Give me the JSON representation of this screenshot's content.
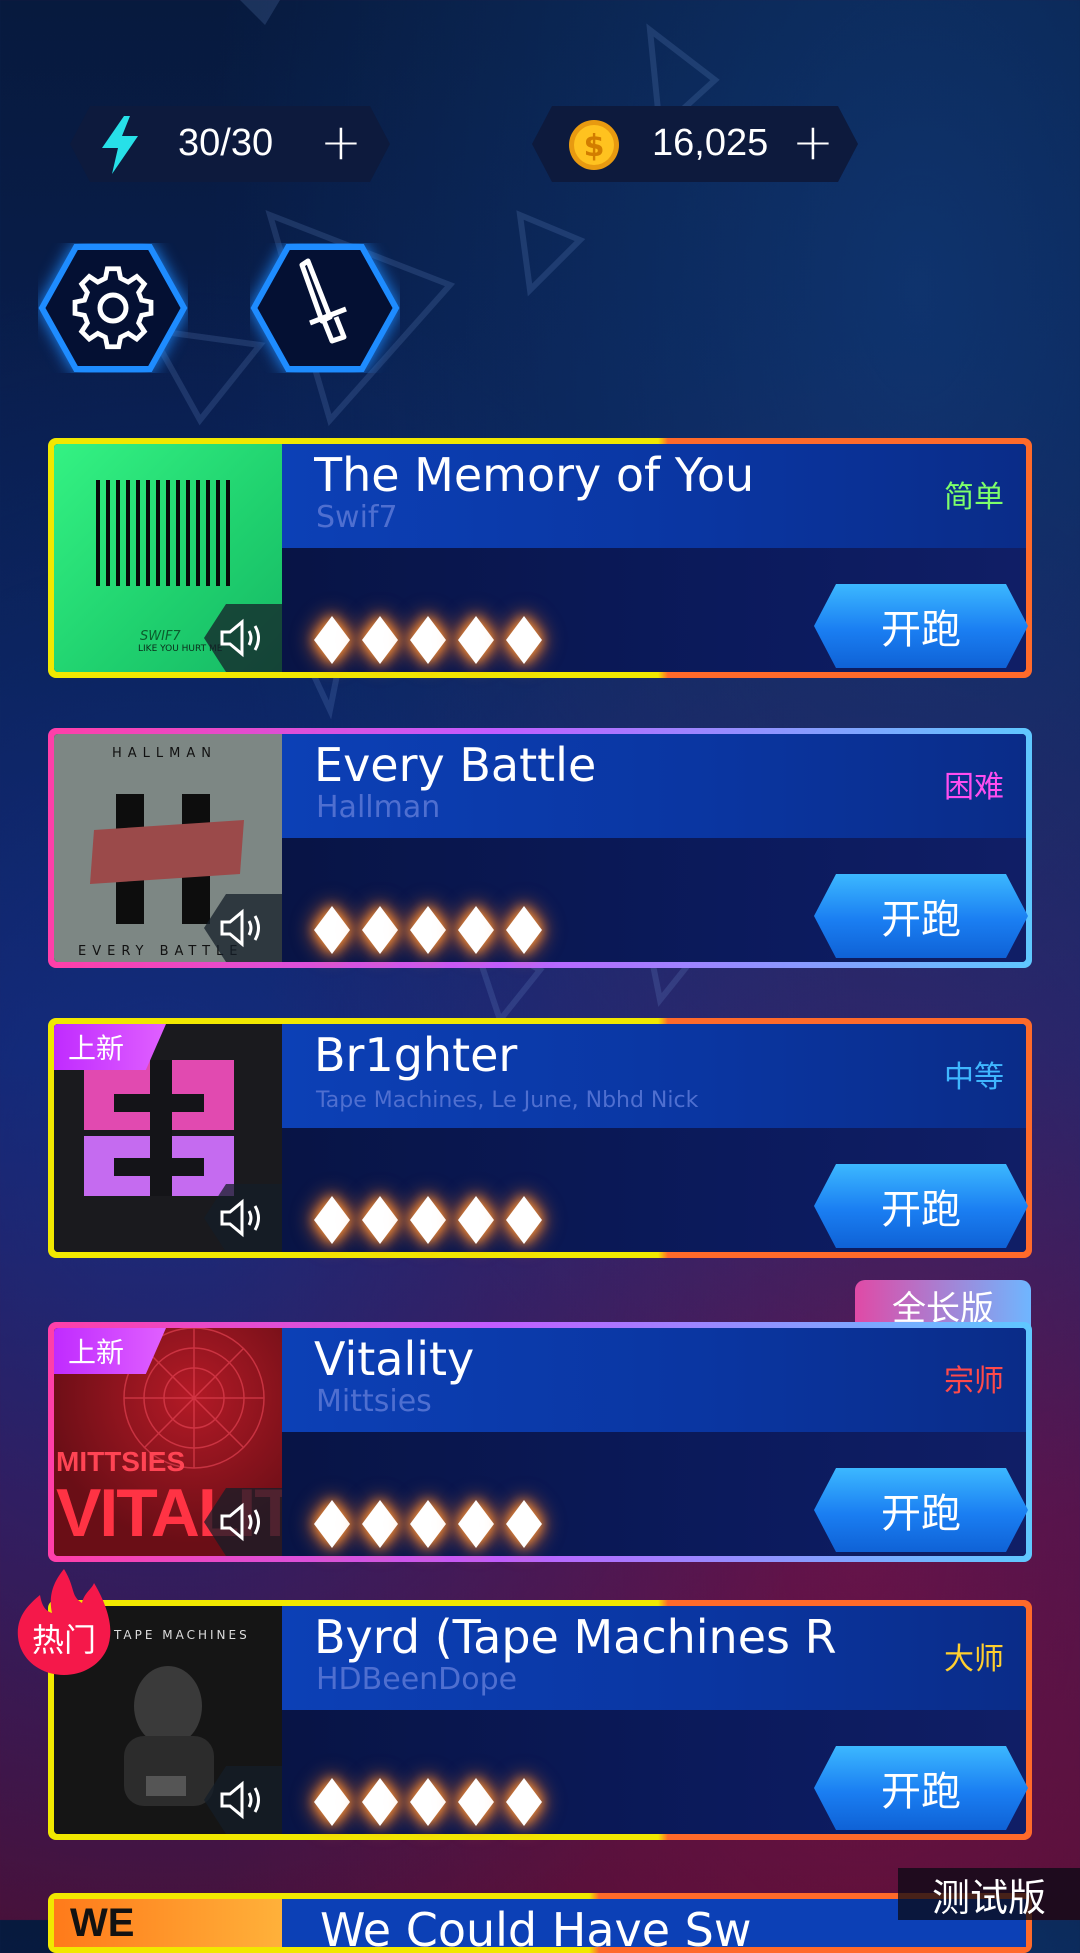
{
  "resources": {
    "energy": "30/30",
    "coins": "16,025",
    "plus": "+"
  },
  "buttons": {
    "run_label": "开跑"
  },
  "songs": [
    {
      "title": "The Memory of You",
      "artist": "Swif7",
      "difficulty": "简单",
      "difficulty_color": "#7dff6a",
      "cover_text_1": "SWIF7",
      "cover_text_2": "LIKE YOU HURT ME"
    },
    {
      "title": "Every Battle",
      "artist": "Hallman",
      "difficulty": "困难",
      "difficulty_color": "#ff4df0",
      "cover_text_1": "HALLMAN",
      "cover_text_2": "EVERY BATTLE"
    },
    {
      "title": "Br1ghter",
      "artist": "Tape Machines, Le June, Nbhd Nick",
      "difficulty": "中等",
      "difficulty_color": "#3fb7ff",
      "badge": "上新"
    },
    {
      "title": "Vitality",
      "artist": "Mittsies",
      "difficulty": "宗师",
      "difficulty_color": "#ff4a4a",
      "badge": "上新",
      "cover_text_1": "MITTSIES",
      "cover_text_2": "VITALITY"
    },
    {
      "title": "Byrd (Tape Machines R",
      "artist": "HDBeenDope",
      "difficulty": "大师",
      "difficulty_color": "#ffcf2e",
      "cover_text_1": "TAPE MACHINES"
    }
  ],
  "tags": {
    "full_version": "全长版",
    "hot": "热门",
    "test_build": "测试版"
  },
  "partial": {
    "cover_text": "WE",
    "title": "We Could Have Sw"
  },
  "icons": {
    "energy": "lightning-bolt-icon",
    "coin": "dollar-coin-icon",
    "settings": "gear-icon",
    "weapon": "sword-icon",
    "speaker": "speaker-icon",
    "rating": "diamond-icon"
  }
}
